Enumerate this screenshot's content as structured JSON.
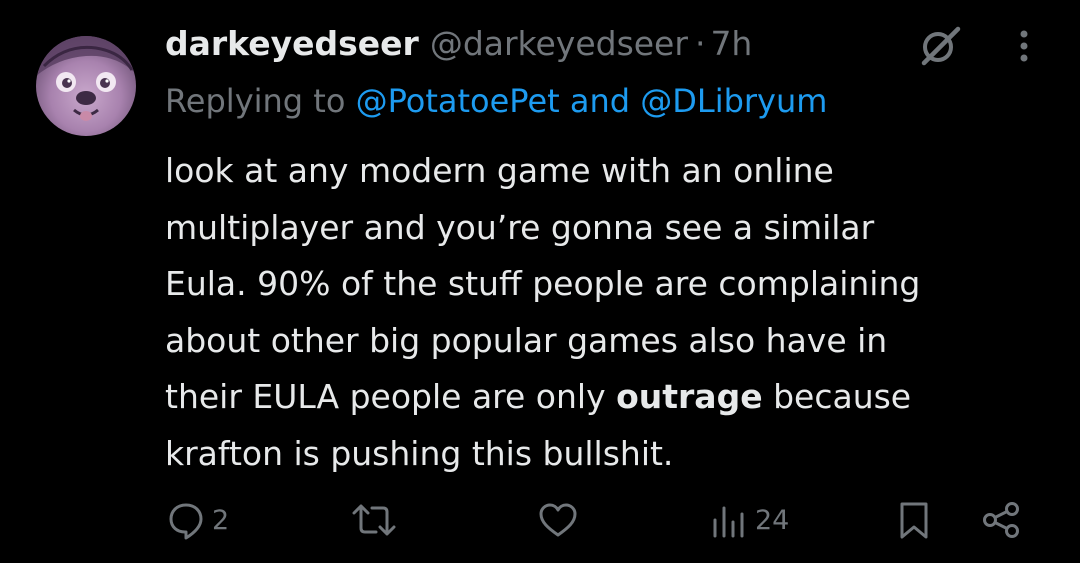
{
  "tweet": {
    "display_name": "darkeyedseer",
    "handle": "@darkeyedseer",
    "separator": "·",
    "time": "7h",
    "reply": {
      "prefix": "Replying to ",
      "mention1": "@PotatoePet",
      "joiner": " and ",
      "mention2": "@DLibryum"
    },
    "body": {
      "line1": "look at any modern game with an online",
      "line2": "multiplayer and you’re gonna see a similar",
      "line3": "Eula.  90% of the stuff people are complaining",
      "line4": "about other big popular games also have in",
      "line5_before": "their EULA people are only ",
      "line5_bold": "outrage",
      "line5_after": " because",
      "line6": "krafton is pushing this bullshit."
    },
    "stats": {
      "replies": "2",
      "views": "24"
    },
    "icons": {
      "grok": "grok-icon",
      "more": "more-dots-icon",
      "reply": "reply-icon",
      "repost": "repost-icon",
      "like": "heart-icon",
      "views": "views-icon",
      "bookmark": "bookmark-icon",
      "share": "share-icon"
    },
    "colors": {
      "background": "#000000",
      "text": "#e7e9ea",
      "muted": "#71767b",
      "link": "#1d9bf0"
    }
  }
}
